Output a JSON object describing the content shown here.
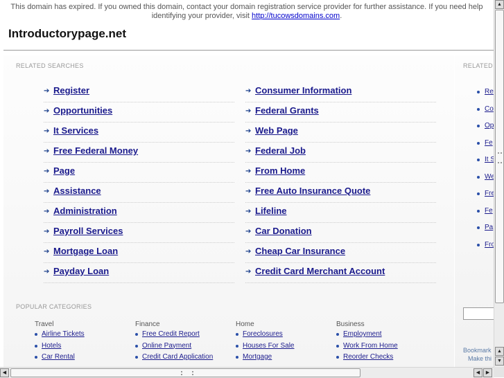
{
  "notice": {
    "text": "This domain has expired. If you owned this domain, contact your domain registration service provider for further assistance. If you need help identifying your provider, visit ",
    "link": "http://tucowsdomains.com",
    "end": "."
  },
  "site_title": "Introductorypage.net",
  "related": {
    "label": "RELATED SEARCHES",
    "left": [
      "Register",
      "Opportunities",
      "It Services",
      "Free Federal Money",
      "Page",
      "Assistance",
      "Administration",
      "Payroll Services",
      "Mortgage Loan",
      "Payday Loan"
    ],
    "right": [
      "Consumer Information",
      "Federal Grants",
      "Web Page",
      "Federal Job",
      "From Home",
      "Free Auto Insurance Quote",
      "Lifeline",
      "Car Donation",
      "Cheap Car Insurance",
      "Credit Card Merchant Account"
    ]
  },
  "popular": {
    "label": "POPULAR CATEGORIES",
    "columns": [
      {
        "head": "Travel",
        "items": [
          "Airline Tickets",
          "Hotels",
          "Car Rental"
        ]
      },
      {
        "head": "Finance",
        "items": [
          "Free Credit Report",
          "Online Payment",
          "Credit Card Application"
        ]
      },
      {
        "head": "Home",
        "items": [
          "Foreclosures",
          "Houses For Sale",
          "Mortgage"
        ]
      },
      {
        "head": "Business",
        "items": [
          "Employment",
          "Work From Home",
          "Reorder Checks"
        ]
      }
    ]
  },
  "sidebar": {
    "label": "RELATED",
    "items": [
      "Re",
      "Co",
      "Op",
      "Fe",
      "It S",
      "We",
      "Fre",
      "Fe",
      "Pa",
      "Fro"
    ],
    "bookmark_line1": "Bookmark",
    "bookmark_line2": "Make thi"
  },
  "colors": {
    "link": "#1a1a8c",
    "arrow": "#1b3f8b",
    "bullet": "#2a4fa8"
  }
}
